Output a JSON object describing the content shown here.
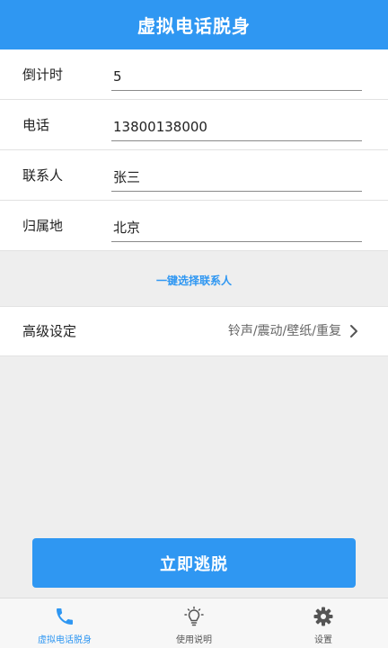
{
  "header": {
    "title": "虚拟电话脱身"
  },
  "form": {
    "countdown": {
      "label": "倒计时",
      "value": "5"
    },
    "phone": {
      "label": "电话",
      "value": "13800138000"
    },
    "contact": {
      "label": "联系人",
      "value": "张三"
    },
    "location": {
      "label": "归属地",
      "value": "北京"
    }
  },
  "quick_select": {
    "label": "一键选择联系人"
  },
  "advanced": {
    "label": "高级设定",
    "summary": "铃声/震动/壁纸/重复",
    "icon": "chevron-right-icon"
  },
  "escape_button": {
    "label": "立即逃脱"
  },
  "tabbar": {
    "tabs": [
      {
        "label": "虚拟电话脱身",
        "icon": "phone-icon",
        "active": true
      },
      {
        "label": "使用说明",
        "icon": "lightbulb-icon",
        "active": false
      },
      {
        "label": "设置",
        "icon": "gear-icon",
        "active": false
      }
    ]
  },
  "colors": {
    "primary": "#2f97f2",
    "background": "#eeeeee",
    "text": "#222222",
    "muted": "#666666"
  }
}
